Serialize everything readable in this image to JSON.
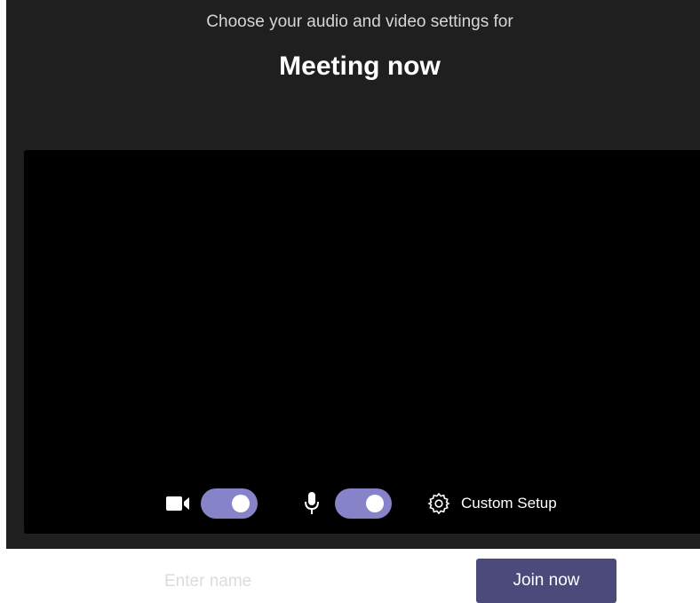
{
  "header": {
    "subtitle": "Choose your audio and video settings for",
    "title": "Meeting now"
  },
  "name_field": {
    "placeholder": "Enter name",
    "value": ""
  },
  "join_button": {
    "label": "Join now"
  },
  "controls": {
    "camera": {
      "icon": "video-camera-icon",
      "enabled": true
    },
    "microphone": {
      "icon": "microphone-icon",
      "enabled": true
    },
    "custom_setup": {
      "icon": "gear-icon",
      "label": "Custom Setup"
    }
  },
  "colors": {
    "background": "#201f1f",
    "preview": "#000000",
    "accent": "#4b4a7a",
    "toggle_on": "#8683c9"
  }
}
